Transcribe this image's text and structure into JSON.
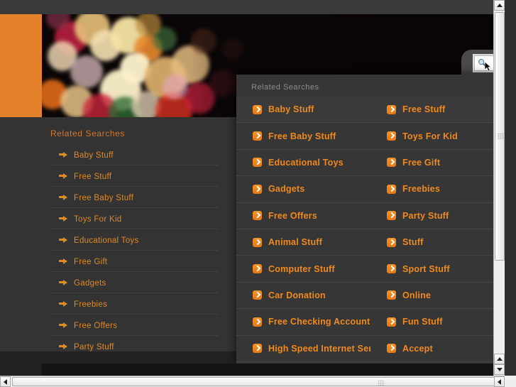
{
  "page": {
    "accent_orange": "#e4812b",
    "link_orange": "#f08a1e",
    "background": "#333333",
    "popup_background": "#363636"
  },
  "search": {
    "placeholder": "",
    "value": "",
    "icon": "magnifier-icon"
  },
  "sidebar": {
    "title": "Related Searches",
    "items": [
      {
        "label": "Baby Stuff"
      },
      {
        "label": "Free Stuff"
      },
      {
        "label": "Free Baby Stuff"
      },
      {
        "label": "Toys For Kid"
      },
      {
        "label": "Educational Toys"
      },
      {
        "label": "Free Gift"
      },
      {
        "label": "Gadgets"
      },
      {
        "label": "Freebies"
      },
      {
        "label": "Free Offers"
      },
      {
        "label": "Party Stuff"
      }
    ]
  },
  "popup": {
    "title": "Related Searches",
    "rows": [
      {
        "left": "Baby Stuff",
        "right": "Free Stuff"
      },
      {
        "left": "Free Baby Stuff",
        "right": "Toys For Kid"
      },
      {
        "left": "Educational Toys",
        "right": "Free Gift"
      },
      {
        "left": "Gadgets",
        "right": "Freebies"
      },
      {
        "left": "Free Offers",
        "right": "Party Stuff"
      },
      {
        "left": "Animal Stuff",
        "right": "Stuff"
      },
      {
        "left": "Computer Stuff",
        "right": "Sport Stuff"
      },
      {
        "left": "Car Donation",
        "right": "Online"
      },
      {
        "left": "Free Checking Account",
        "right": "Fun Stuff"
      },
      {
        "left": "High Speed Internet Service",
        "right": "Accept"
      }
    ]
  },
  "scrollbars": {
    "vertical": {
      "up": "▲",
      "down": "▼"
    },
    "horizontal": {
      "left": "◀",
      "right": "▶"
    }
  }
}
